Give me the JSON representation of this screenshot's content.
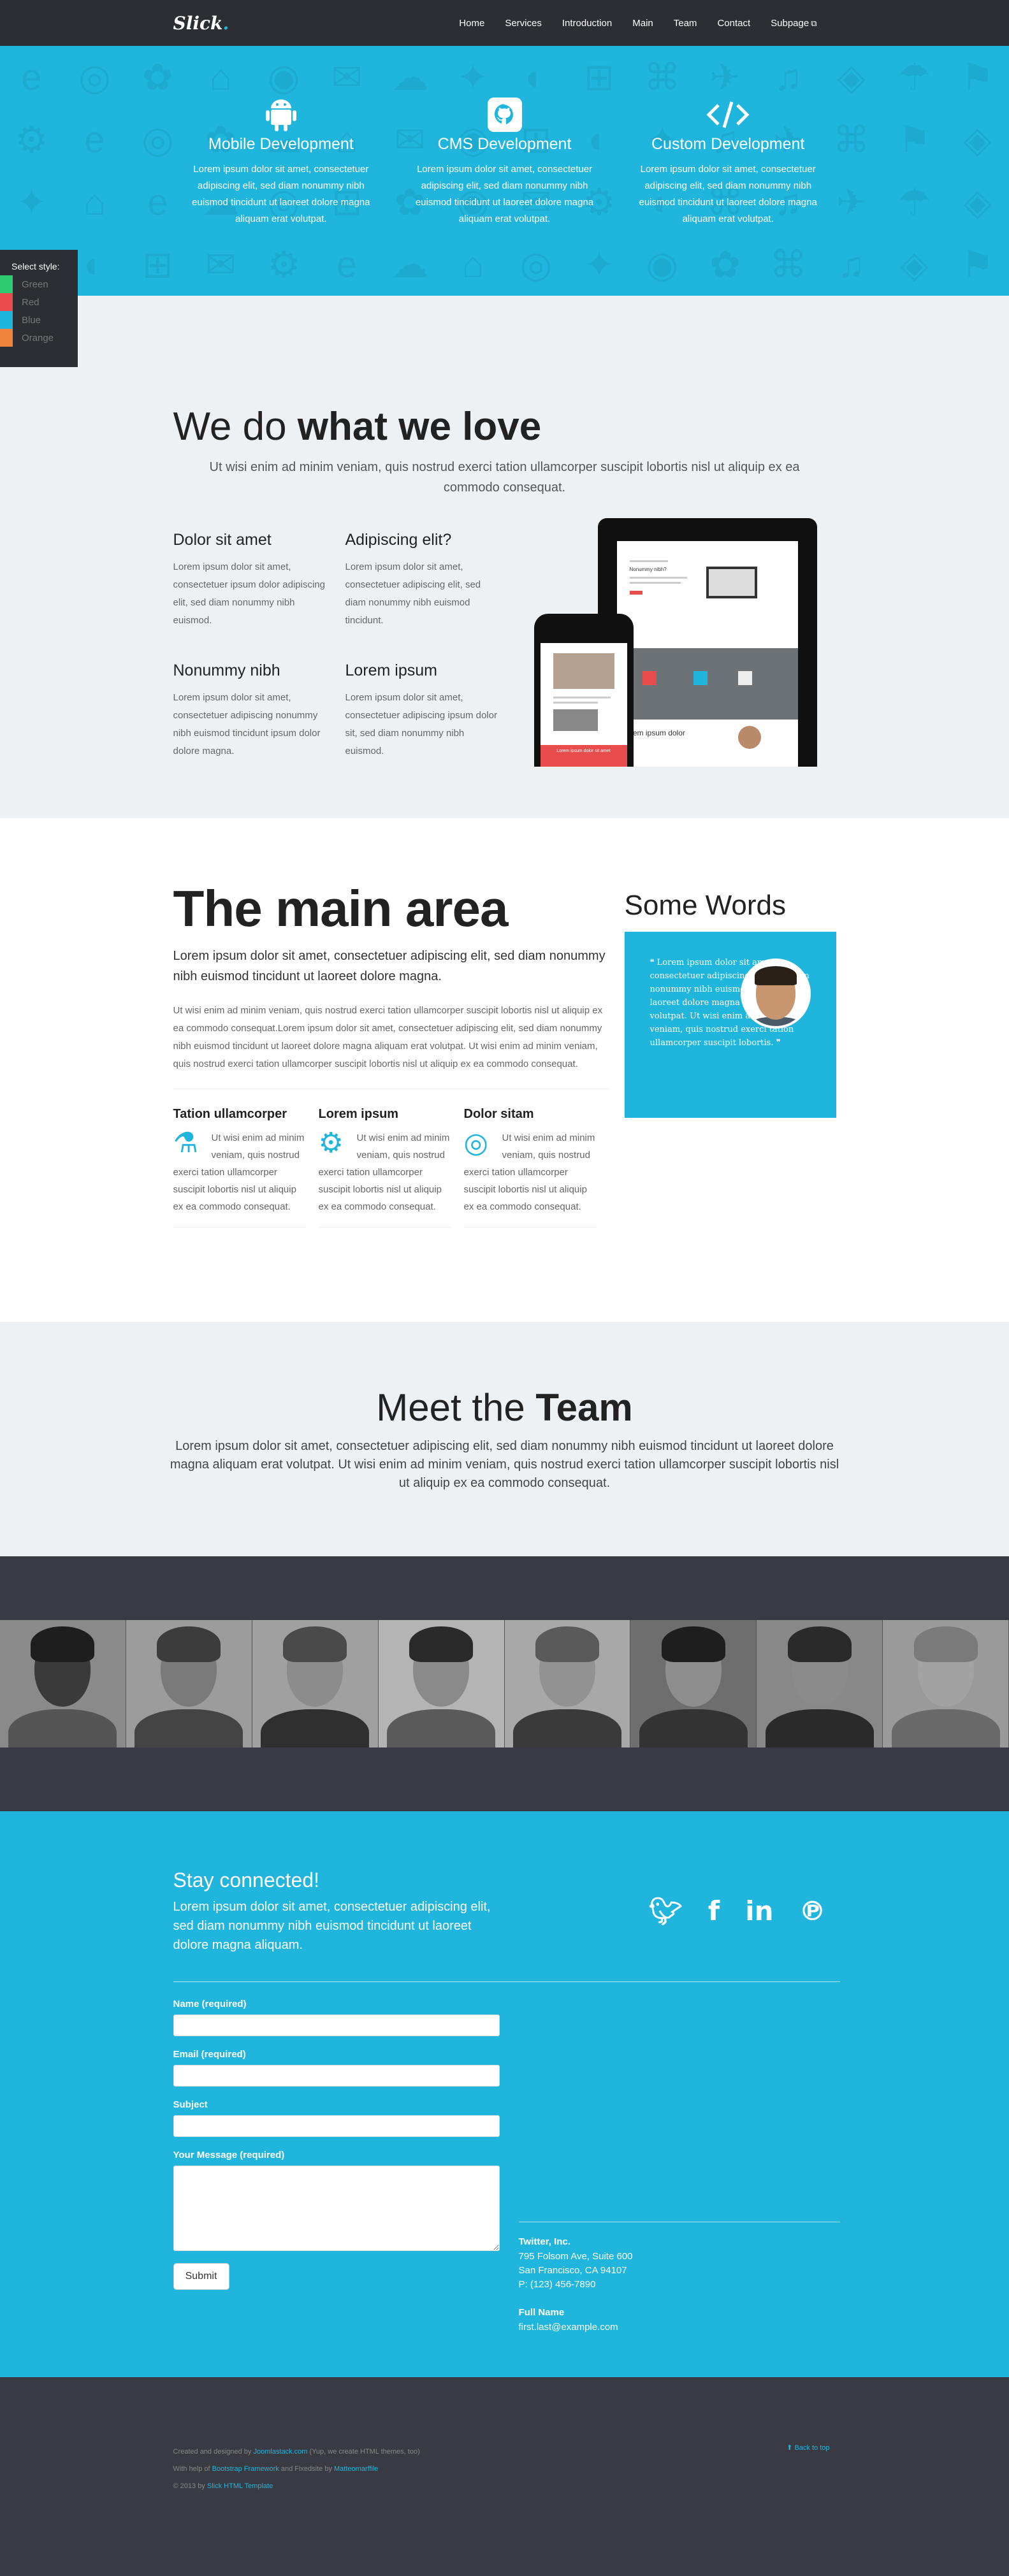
{
  "nav": {
    "brand": "Slick",
    "items": [
      "Home",
      "Services",
      "Introduction",
      "Main",
      "Team",
      "Contact",
      "Subpage"
    ]
  },
  "hero": {
    "features": [
      {
        "title": "Mobile Development",
        "text": "Lorem ipsum dolor sit amet, consectetuer adipiscing elit, sed diam nonummy nibh euismod tincidunt ut laoreet dolore magna aliquam erat volutpat."
      },
      {
        "title": "CMS Development",
        "text": "Lorem ipsum dolor sit amet, consectetuer adipiscing elit, sed diam nonummy nibh euismod tincidunt ut laoreet dolore magna aliquam erat volutpat."
      },
      {
        "title": "Custom Development",
        "text": "Lorem ipsum dolor sit amet, consectetuer adipiscing elit, sed diam nonummy nibh euismod tincidunt ut laoreet dolore magna aliquam erat volutpat."
      }
    ]
  },
  "switcher": {
    "title": "Select style:",
    "options": [
      {
        "label": "Green",
        "color": "#2ecc71"
      },
      {
        "label": "Red",
        "color": "#e84c4c"
      },
      {
        "label": "Blue",
        "color": "#1fb5dd"
      },
      {
        "label": "Orange",
        "color": "#f0843c"
      }
    ]
  },
  "love": {
    "title_plain": "We do ",
    "title_bold": "what we love",
    "lead": "Ut wisi enim ad minim veniam, quis nostrud exerci tation ullamcorper suscipit lobortis nisl ut aliquip ex ea commodo consequat.",
    "items": [
      {
        "title": "Dolor sit amet",
        "text": "Lorem ipsum dolor sit amet, consectetuer ipsum dolor adipiscing elit, sed diam nonummy nibh euismod."
      },
      {
        "title": "Adipiscing elit?",
        "text": "Lorem ipsum dolor sit amet, consectetuer adipiscing elit, sed diam nonummy nibh euismod tincidunt."
      },
      {
        "title": "Nonummy nibh",
        "text": "Lorem ipsum dolor sit amet, consectetuer adipiscing nonummy nibh euismod tincidunt ipsum dolor dolore magna."
      },
      {
        "title": "Lorem ipsum",
        "text": "Lorem ipsum dolor sit amet, consectetuer adipiscing ipsum dolor sit, sed diam nonummy nibh euismod."
      }
    ],
    "tablet_title": "Nonummy nibh?",
    "tablet_caption": "Lorem ipsum dolor",
    "phone_caption": "Lorem ipsum dolor sit amet"
  },
  "main": {
    "title": "The main area",
    "sub": "Lorem ipsum dolor sit amet, consectetuer adipiscing elit, sed diam nonummy nibh euismod tincidunt ut laoreet dolore magna.",
    "body": "Ut wisi enim ad minim veniam, quis nostrud exerci tation ullamcorper suscipit lobortis nisl ut aliquip ex ea commodo consequat.Lorem ipsum dolor sit amet, consectetuer adipiscing elit, sed diam nonummy nibh euismod tincidunt ut laoreet dolore magna aliquam erat volutpat. Ut wisi enim ad minim veniam, quis nostrud exerci tation ullamcorper suscipit lobortis nisl ut aliquip ex ea commodo consequat.",
    "cols": [
      {
        "title": "Tation ullamcorper",
        "icon": "flask-icon",
        "text": "Ut wisi enim ad minim veniam, quis nostrud exerci tation ullamcorper suscipit lobortis nisl ut aliquip ex ea commodo consequat."
      },
      {
        "title": "Lorem ipsum",
        "icon": "gears-icon",
        "text": "Ut wisi enim ad minim veniam, quis nostrud exerci tation ullamcorper suscipit lobortis nisl ut aliquip ex ea commodo consequat."
      },
      {
        "title": "Dolor sitam",
        "icon": "compass-icon",
        "text": "Ut wisi enim ad minim veniam, quis nostrud exerci tation ullamcorper suscipit lobortis nisl ut aliquip ex ea commodo consequat."
      }
    ],
    "aside_title": "Some Words",
    "quote": "Lorem ipsum dolor sit amet, consectetuer adipiscing elit, sed diam nonummy nibh euismod tincidunt ut laoreet dolore magna aliquam erat volutpat. Ut wisi enim ad minim veniam, quis nostrud exerci tation ullamcorper suscipit lobortis."
  },
  "team": {
    "title_plain": "Meet the ",
    "title_bold": "Team",
    "text": "Lorem ipsum dolor sit amet, consectetuer adipiscing elit, sed diam nonummy nibh euismod tincidunt ut laoreet dolore magna aliquam erat volutpat. Ut wisi enim ad minim veniam, quis nostrud exerci tation ullamcorper suscipit lobortis nisl ut aliquip ex ea commodo consequat."
  },
  "contact": {
    "title": "Stay connected!",
    "lead": "Lorem ipsum dolor sit amet, consectetuer adipiscing elit, sed diam nonummy nibh euismod tincidunt ut laoreet dolore magna aliquam.",
    "social": [
      "twitter-icon",
      "facebook-icon",
      "linkedin-icon",
      "pinterest-icon"
    ],
    "form": {
      "name_label": "Name (required)",
      "email_label": "Email (required)",
      "subject_label": "Subject",
      "message_label": "Your Message (required)",
      "submit": "Submit"
    },
    "company": "Twitter, Inc.",
    "address1": "795 Folsom Ave, Suite 600",
    "address2": "San Francisco, CA 94107",
    "phone": "P: (123) 456-7890",
    "person": "Full Name",
    "email": "first.last@example.com"
  },
  "footer": {
    "line1_pre": "Created and designed by ",
    "line1_link": "Joomlastack.com",
    "line1_post": " (Yup, we create HTML themes, too)",
    "line2_pre": "With help of ",
    "line2_link1": "Bootstrap Framework",
    "line2_mid": " and Fixedsite by ",
    "line2_link2": "Matteomarffile",
    "line3_pre": "© 2013 by ",
    "line3_link": "Slick HTML Template",
    "back_to_top": "Back to top"
  }
}
